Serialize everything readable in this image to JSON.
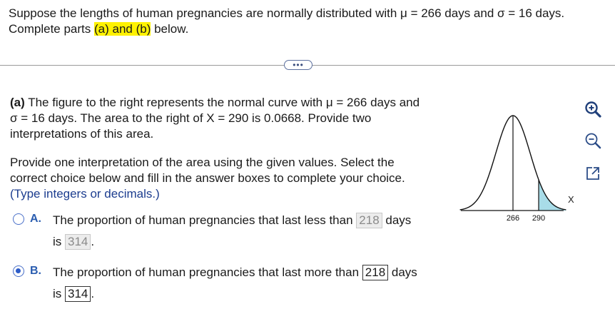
{
  "question": {
    "line1": "Suppose the lengths of human pregnancies are normally distributed with μ = 266 days and σ = 16 days.",
    "line2_pre": "Complete parts ",
    "line2_highlight": "(a) and (b)",
    "line2_post": " below."
  },
  "expander_label": "•••",
  "part_a": {
    "label": "(a)",
    "line1": " The figure to the right represents the normal curve with μ = 266 days and",
    "line2": "σ = 16 days. The area to the right of X = 290 is 0.0668. Provide two",
    "line3": "interpretations of this area."
  },
  "instructions": {
    "line1": "Provide one interpretation of the area using the given values. Select the",
    "line2": "correct choice below and fill in the answer boxes to complete your choice.",
    "hint": "(Type integers or decimals.)"
  },
  "options": [
    {
      "letter": "A.",
      "text_pre": "The proportion of human pregnancies that last less than",
      "box1": "218",
      "text_mid": "days",
      "text_is": "is",
      "box2": "314",
      "period": ".",
      "selected": false
    },
    {
      "letter": "B.",
      "text_pre": "The proportion of human pregnancies that last more than",
      "box1": "218",
      "text_mid": "days",
      "text_is": "is",
      "box2": "314",
      "period": ".",
      "selected": true
    }
  ],
  "figure": {
    "tick_mean": "266",
    "tick_x": "290",
    "axis_label": "X",
    "shade_color": "#a8dce8"
  },
  "tools": [
    "zoom-in-icon",
    "zoom-out-icon",
    "pop-out-icon"
  ]
}
